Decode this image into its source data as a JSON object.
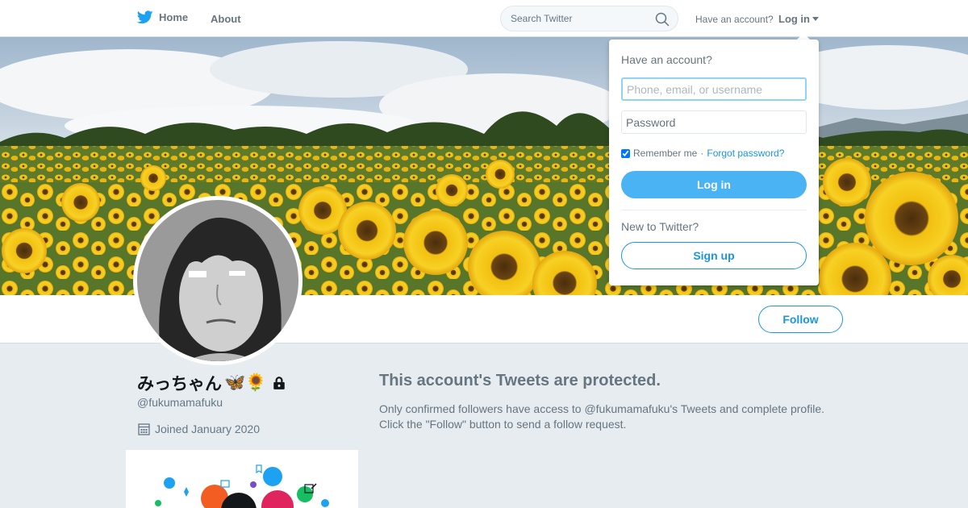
{
  "topnav": {
    "home_label": "Home",
    "about_label": "About",
    "search_placeholder": "Search Twitter",
    "have_account": "Have an account?",
    "login_label": "Log in"
  },
  "profile": {
    "name": "みっちゃん",
    "name_emoji": "🦋🌻",
    "handle": "@fukumamafuku",
    "joined": "Joined January 2020",
    "follow_label": "Follow"
  },
  "protected": {
    "title": "This account's Tweets are protected.",
    "line1": "Only confirmed followers have access to @fukumamafuku's Tweets and complete profile.",
    "line2": "Click the \"Follow\" button to send a follow request."
  },
  "login_dropdown": {
    "title": "Have an account?",
    "username_placeholder": "Phone, email, or username",
    "password_placeholder": "Password",
    "remember_label": "Remember me",
    "separator": "·",
    "forgot_label": "Forgot password?",
    "login_button": "Log in",
    "new_to": "New to Twitter?",
    "signup_button": "Sign up",
    "remember_checked": true
  },
  "colors": {
    "brand_blue": "#1da1f2",
    "link_blue": "#1b95e0",
    "button_blue": "#4ab3f4",
    "page_bg": "#e6ecf0",
    "muted_text": "#66757f"
  }
}
